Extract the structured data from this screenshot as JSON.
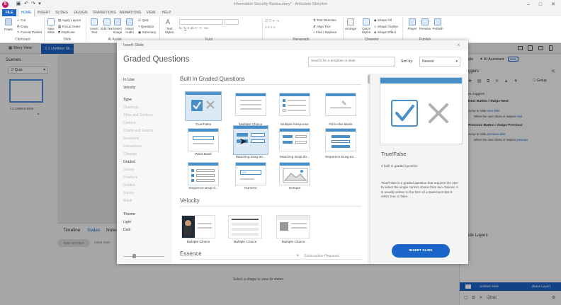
{
  "app": {
    "title": "Information Security Basics.story* - Articulate Storyline",
    "icon_glyph": "S"
  },
  "menu": {
    "tabs": [
      "FILE",
      "HOME",
      "INSERT",
      "SLIDES",
      "DESIGN",
      "TRANSITIONS",
      "ANIMATIONS",
      "VIEW",
      "HELP"
    ]
  },
  "ribbon": {
    "clipboard": {
      "paste": "Paste",
      "cut": "Cut",
      "copy": "Copy",
      "format_painter": "Format Painter",
      "group": "Clipboard"
    },
    "slide": {
      "new_slide": "New Slide",
      "apply_layout": "Apply Layout",
      "focus_order": "Focus Order",
      "duplicate": "Duplicate",
      "group": "Slide"
    },
    "insert": {
      "insert_text": "Insert Text",
      "edit_text": "Edit Text",
      "insert_image": "Insert Image",
      "insert_audio": "Insert Audio",
      "ai_label": "AI Assist"
    },
    "quiz": {
      "quiz": "Quiz",
      "question": "Question",
      "summary": "Summary"
    },
    "text_styles": "Text Styles",
    "font_group": "Font",
    "paragraph": {
      "text_direction": "Text Direction",
      "align_text": "Align Text",
      "find_replace": "Find / Replace",
      "group": "Paragraph"
    },
    "arrange": "Arrange",
    "quick_styles": "Quick Styles",
    "shape": {
      "fill": "Shape Fill",
      "outline": "Shape Outline",
      "effect": "Shape Effect"
    },
    "drawing_group": "Drawing",
    "publish": {
      "player": "Player",
      "preview": "Preview",
      "publish": "Publish",
      "group": "Publish"
    }
  },
  "viewbar": {
    "story_view": "Story View",
    "slide_tab": "2.1 Untitled Sli..."
  },
  "scenes": {
    "title": "Scenes",
    "selected": "2 Quiz",
    "thumb_label": "2.1 Untitled Slide"
  },
  "bottom": {
    "tabs": [
      "Timeline",
      "States",
      "Notes"
    ],
    "edit_states": "EDIT STATES",
    "initial_state": "Initial state",
    "hint": "Select a shape to view its states"
  },
  "rightpanel": {
    "tab_slide": "ide",
    "tab_ai": "AI Assistant",
    "new_badge": "New",
    "triggers_title": "ggers",
    "group_label": "Group",
    "player_triggers": "er Triggers",
    "next_section": "Next Button / Swipe Next",
    "next_line1_pre": "Jump to slide ",
    "next_line1_link": "next slide",
    "next_line2_pre": "When the user clicks or swipes ",
    "next_line2_link": "next",
    "prev_section": "Previous Button / Swipe Previous",
    "prev_line1_pre": "Jump to slide ",
    "prev_line1_link": "previous slide",
    "prev_line2_pre": "When the user clicks or swipes ",
    "prev_line2_link": "previous",
    "layers_title": "ide Layers",
    "base_layer_name": "Untitled Slide",
    "base_layer_tag": "(Base Layer)",
    "dim": "Dim"
  },
  "dialog": {
    "title": "Insert Slide",
    "heading": "Graded Questions",
    "search_placeholder": "Search for a template or slide",
    "sort_label": "Sort by:",
    "sort_value": "Newest",
    "filters": {
      "in_use_head": "In Use",
      "in_use": [
        "Velocity"
      ],
      "type_head": "Type",
      "types": [
        "Openings",
        "Titles and Sections",
        "Content",
        "Charts and Graphs",
        "Scenarios",
        "Interactions",
        "Closings",
        "Graded",
        "Survey",
        "Freeform",
        "Graded",
        "Survey",
        "Blank"
      ],
      "theme_head": "Theme",
      "themes": [
        "Light",
        "Dark"
      ]
    },
    "section1_title": "Built In Graded Questions",
    "tiles": [
      "True/False",
      "Multiple Choice",
      "Multiple Response",
      "Fill-in-the-Blank",
      "Word Bank",
      "Matching  Drag-an...",
      "Matching  Drop-do...",
      "Sequence  Drag-an...",
      "Sequence  Drop-d...",
      "Numeric",
      "Hotspot"
    ],
    "section2_title": "Velocity",
    "velocity_tiles": [
      "Multiple Choice",
      "Multiple Choice",
      "Multiple Choice"
    ],
    "section3_title": "Essence",
    "subscription": "Subscription Required",
    "preview": {
      "title": "True/False",
      "subtitle": "A built in graded question",
      "description": "True/False is a graded question that requires the user to select the single correct choice from two choices. It is usually written in the form of a statement that is either true or false.",
      "button": "INSERT SLIDE"
    }
  },
  "colors": {
    "accent": "#1b64c8",
    "tile_header": "#4a90c8",
    "brand": "#c2185b"
  }
}
